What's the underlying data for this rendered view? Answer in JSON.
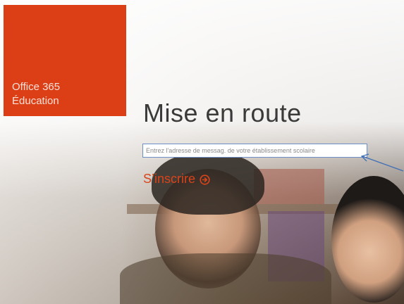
{
  "brand": {
    "line1": "Office 365",
    "line2": "Éducation",
    "tile_color": "#dc3e15"
  },
  "page": {
    "title": "Mise en route"
  },
  "email": {
    "placeholder": "Entrez l'adresse de messag. de votre établissement scolaire",
    "value": ""
  },
  "signup": {
    "label": "S’inscrire",
    "icon": "circle-arrow-right-icon",
    "color": "#d9441a"
  },
  "colors": {
    "input_border": "#6d8fc7",
    "annotation_arrow": "#3f6fb5"
  }
}
